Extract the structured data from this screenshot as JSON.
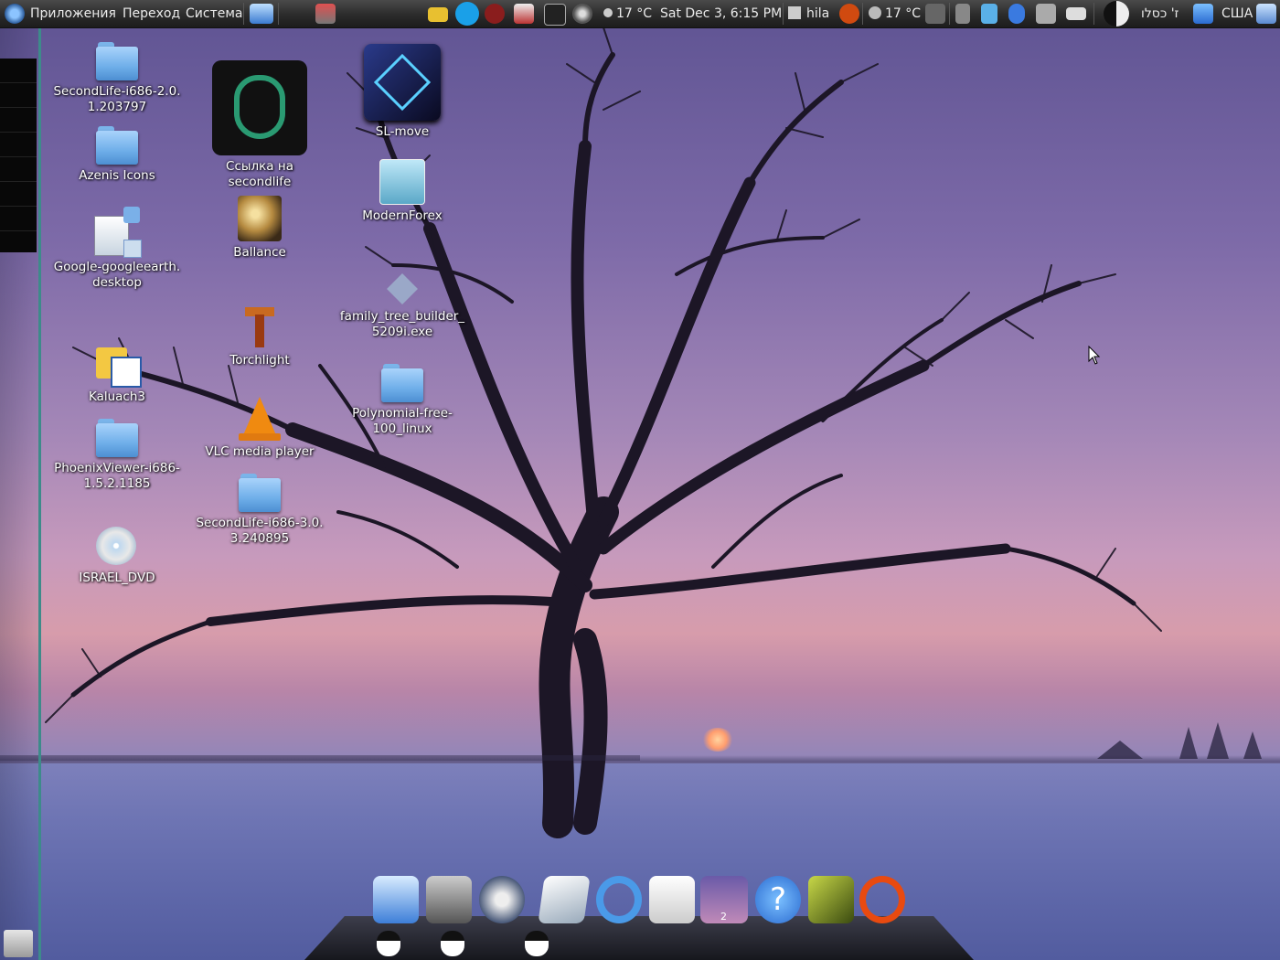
{
  "top_panel": {
    "menus": [
      "Приложения",
      "Переход",
      "Система"
    ],
    "weather_temp": "17 °C",
    "clock": "Sat Dec  3,  6:15 PM",
    "user": "hila",
    "weather_temp_2": "17 °C",
    "hebrew_date": "ז' כסלו",
    "keyboard_layout": "США"
  },
  "desktop_icons": [
    {
      "label": "SecondLife-i686-2.0.\n1.203797",
      "icon": "folder-icon"
    },
    {
      "label": "Azenis Icons",
      "icon": "folder-icon"
    },
    {
      "label": "Google-googleearth.\ndesktop",
      "icon": "desktop-file-icon"
    },
    {
      "label": "Kaluach3",
      "icon": "calendar-folder-icon"
    },
    {
      "label": "PhoenixViewer-i686-\n1.5.2.1185",
      "icon": "folder-icon"
    },
    {
      "label": "ISRAEL_DVD",
      "icon": "dvd-icon"
    },
    {
      "label": "Ссылка на\nsecondlife",
      "icon": "second-life-hand-icon"
    },
    {
      "label": "Ballance",
      "icon": "ballance-icon"
    },
    {
      "label": "Torchlight",
      "icon": "torchlight-icon"
    },
    {
      "label": "VLC media player",
      "icon": "vlc-cone-icon"
    },
    {
      "label": "SecondLife-i686-3.0.\n3.240895",
      "icon": "folder-icon"
    },
    {
      "label": "SL-move",
      "icon": "media-icon"
    },
    {
      "label": "ModernForex",
      "icon": "image-icon"
    },
    {
      "label": "family_tree_builder_\n5209i.exe",
      "icon": "exe-icon"
    },
    {
      "label": "Polynomial-free-\n100_linux",
      "icon": "folder-icon"
    }
  ],
  "dock": {
    "items": [
      "firefox-icon",
      "calculator-icon",
      "graphics-icon",
      "text-editor-icon",
      "ring-icon",
      "notes-icon",
      "workspace-switcher-icon",
      "help-icon",
      "image-viewer-icon",
      "power-icon"
    ],
    "workspace_number": "2"
  },
  "colors": {
    "panel_bg": "#2b2b2b",
    "left_strip_accent": "#3d8b8a",
    "sky_top": "#5e5392",
    "sunset": "#d79cab"
  }
}
